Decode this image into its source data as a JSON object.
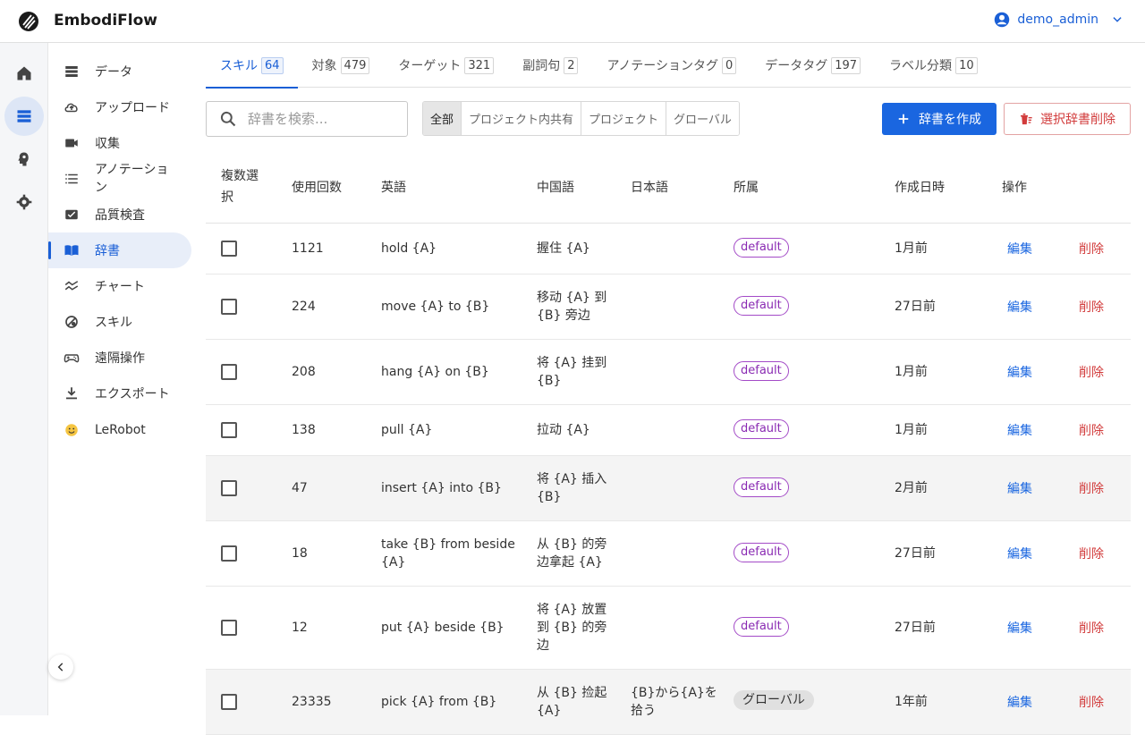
{
  "app": {
    "title": "EmbodiFlow"
  },
  "user": {
    "name": "demo_admin"
  },
  "rail": [
    {
      "icon": "home-icon"
    },
    {
      "icon": "storage-icon",
      "active": true
    },
    {
      "icon": "brain-icon"
    },
    {
      "icon": "gear-icon"
    }
  ],
  "sidebar": {
    "items": [
      {
        "label": "データ",
        "icon": "database-icon"
      },
      {
        "label": "アップロード",
        "icon": "cloud-upload-icon"
      },
      {
        "label": "収集",
        "icon": "video-camera-icon"
      },
      {
        "label": "アノテーション",
        "icon": "list-icon"
      },
      {
        "label": "品質検査",
        "icon": "check-box-icon"
      },
      {
        "label": "辞書",
        "icon": "book-icon",
        "active": true
      },
      {
        "label": "チャート",
        "icon": "chart-icon"
      },
      {
        "label": "スキル",
        "icon": "skill-icon"
      },
      {
        "label": "遠隔操作",
        "icon": "gamepad-icon"
      },
      {
        "label": "エクスポート",
        "icon": "download-icon"
      },
      {
        "label": "LeRobot",
        "icon": "hug-emoji-icon"
      }
    ]
  },
  "tabs": [
    {
      "label": "スキル",
      "count": "64",
      "active": true
    },
    {
      "label": "対象",
      "count": "479"
    },
    {
      "label": "ターゲット",
      "count": "321"
    },
    {
      "label": "副詞句",
      "count": "2"
    },
    {
      "label": "アノテーションタグ",
      "count": "0"
    },
    {
      "label": "データタグ",
      "count": "197"
    },
    {
      "label": "ラベル分類",
      "count": "10"
    }
  ],
  "search": {
    "placeholder": "辞書を検索..."
  },
  "filters": [
    "全部",
    "プロジェクト内共有",
    "プロジェクト",
    "グローバル"
  ],
  "actions": {
    "create": "辞書を作成",
    "delete_selected": "選択辞書削除"
  },
  "table": {
    "headers": {
      "select": "複数選択",
      "usage": "使用回数",
      "english": "英語",
      "chinese": "中国語",
      "japanese": "日本語",
      "owner": "所属",
      "created": "作成日時",
      "ops": "操作"
    },
    "edit_label": "編集",
    "delete_label": "削除",
    "rows": [
      {
        "usage": "1121",
        "english": "hold {A}",
        "chinese": "握住 {A}",
        "japanese": "",
        "owner": "default",
        "created": "1月前"
      },
      {
        "usage": "224",
        "english": "move {A} to {B}",
        "chinese": "移动 {A} 到 {B} 旁边",
        "japanese": "",
        "owner": "default",
        "created": "27日前"
      },
      {
        "usage": "208",
        "english": "hang {A} on {B}",
        "chinese": "将 {A} 挂到 {B}",
        "japanese": "",
        "owner": "default",
        "created": "1月前"
      },
      {
        "usage": "138",
        "english": "pull {A}",
        "chinese": "拉动 {A}",
        "japanese": "",
        "owner": "default",
        "created": "1月前"
      },
      {
        "usage": "47",
        "english": "insert {A} into {B}",
        "chinese": "将 {A} 插入 {B}",
        "japanese": "",
        "owner": "default",
        "created": "2月前"
      },
      {
        "usage": "18",
        "english": "take {B} from beside {A}",
        "chinese": "从 {B} 的旁边拿起 {A}",
        "japanese": "",
        "owner": "default",
        "created": "27日前"
      },
      {
        "usage": "12",
        "english": "put {A} beside {B}",
        "chinese": "将 {A} 放置到 {B} 的旁边",
        "japanese": "",
        "owner": "default",
        "created": "27日前"
      },
      {
        "usage": "23335",
        "english": "pick {A} from {B}",
        "chinese": "从 {B} 捡起 {A}",
        "japanese": "{B}から{A}を拾う",
        "owner": "グローバル",
        "created": "1年前"
      }
    ]
  },
  "colors": {
    "accent": "#1a66e0",
    "danger": "#d23c3c",
    "badge": "#8a2bb3"
  }
}
